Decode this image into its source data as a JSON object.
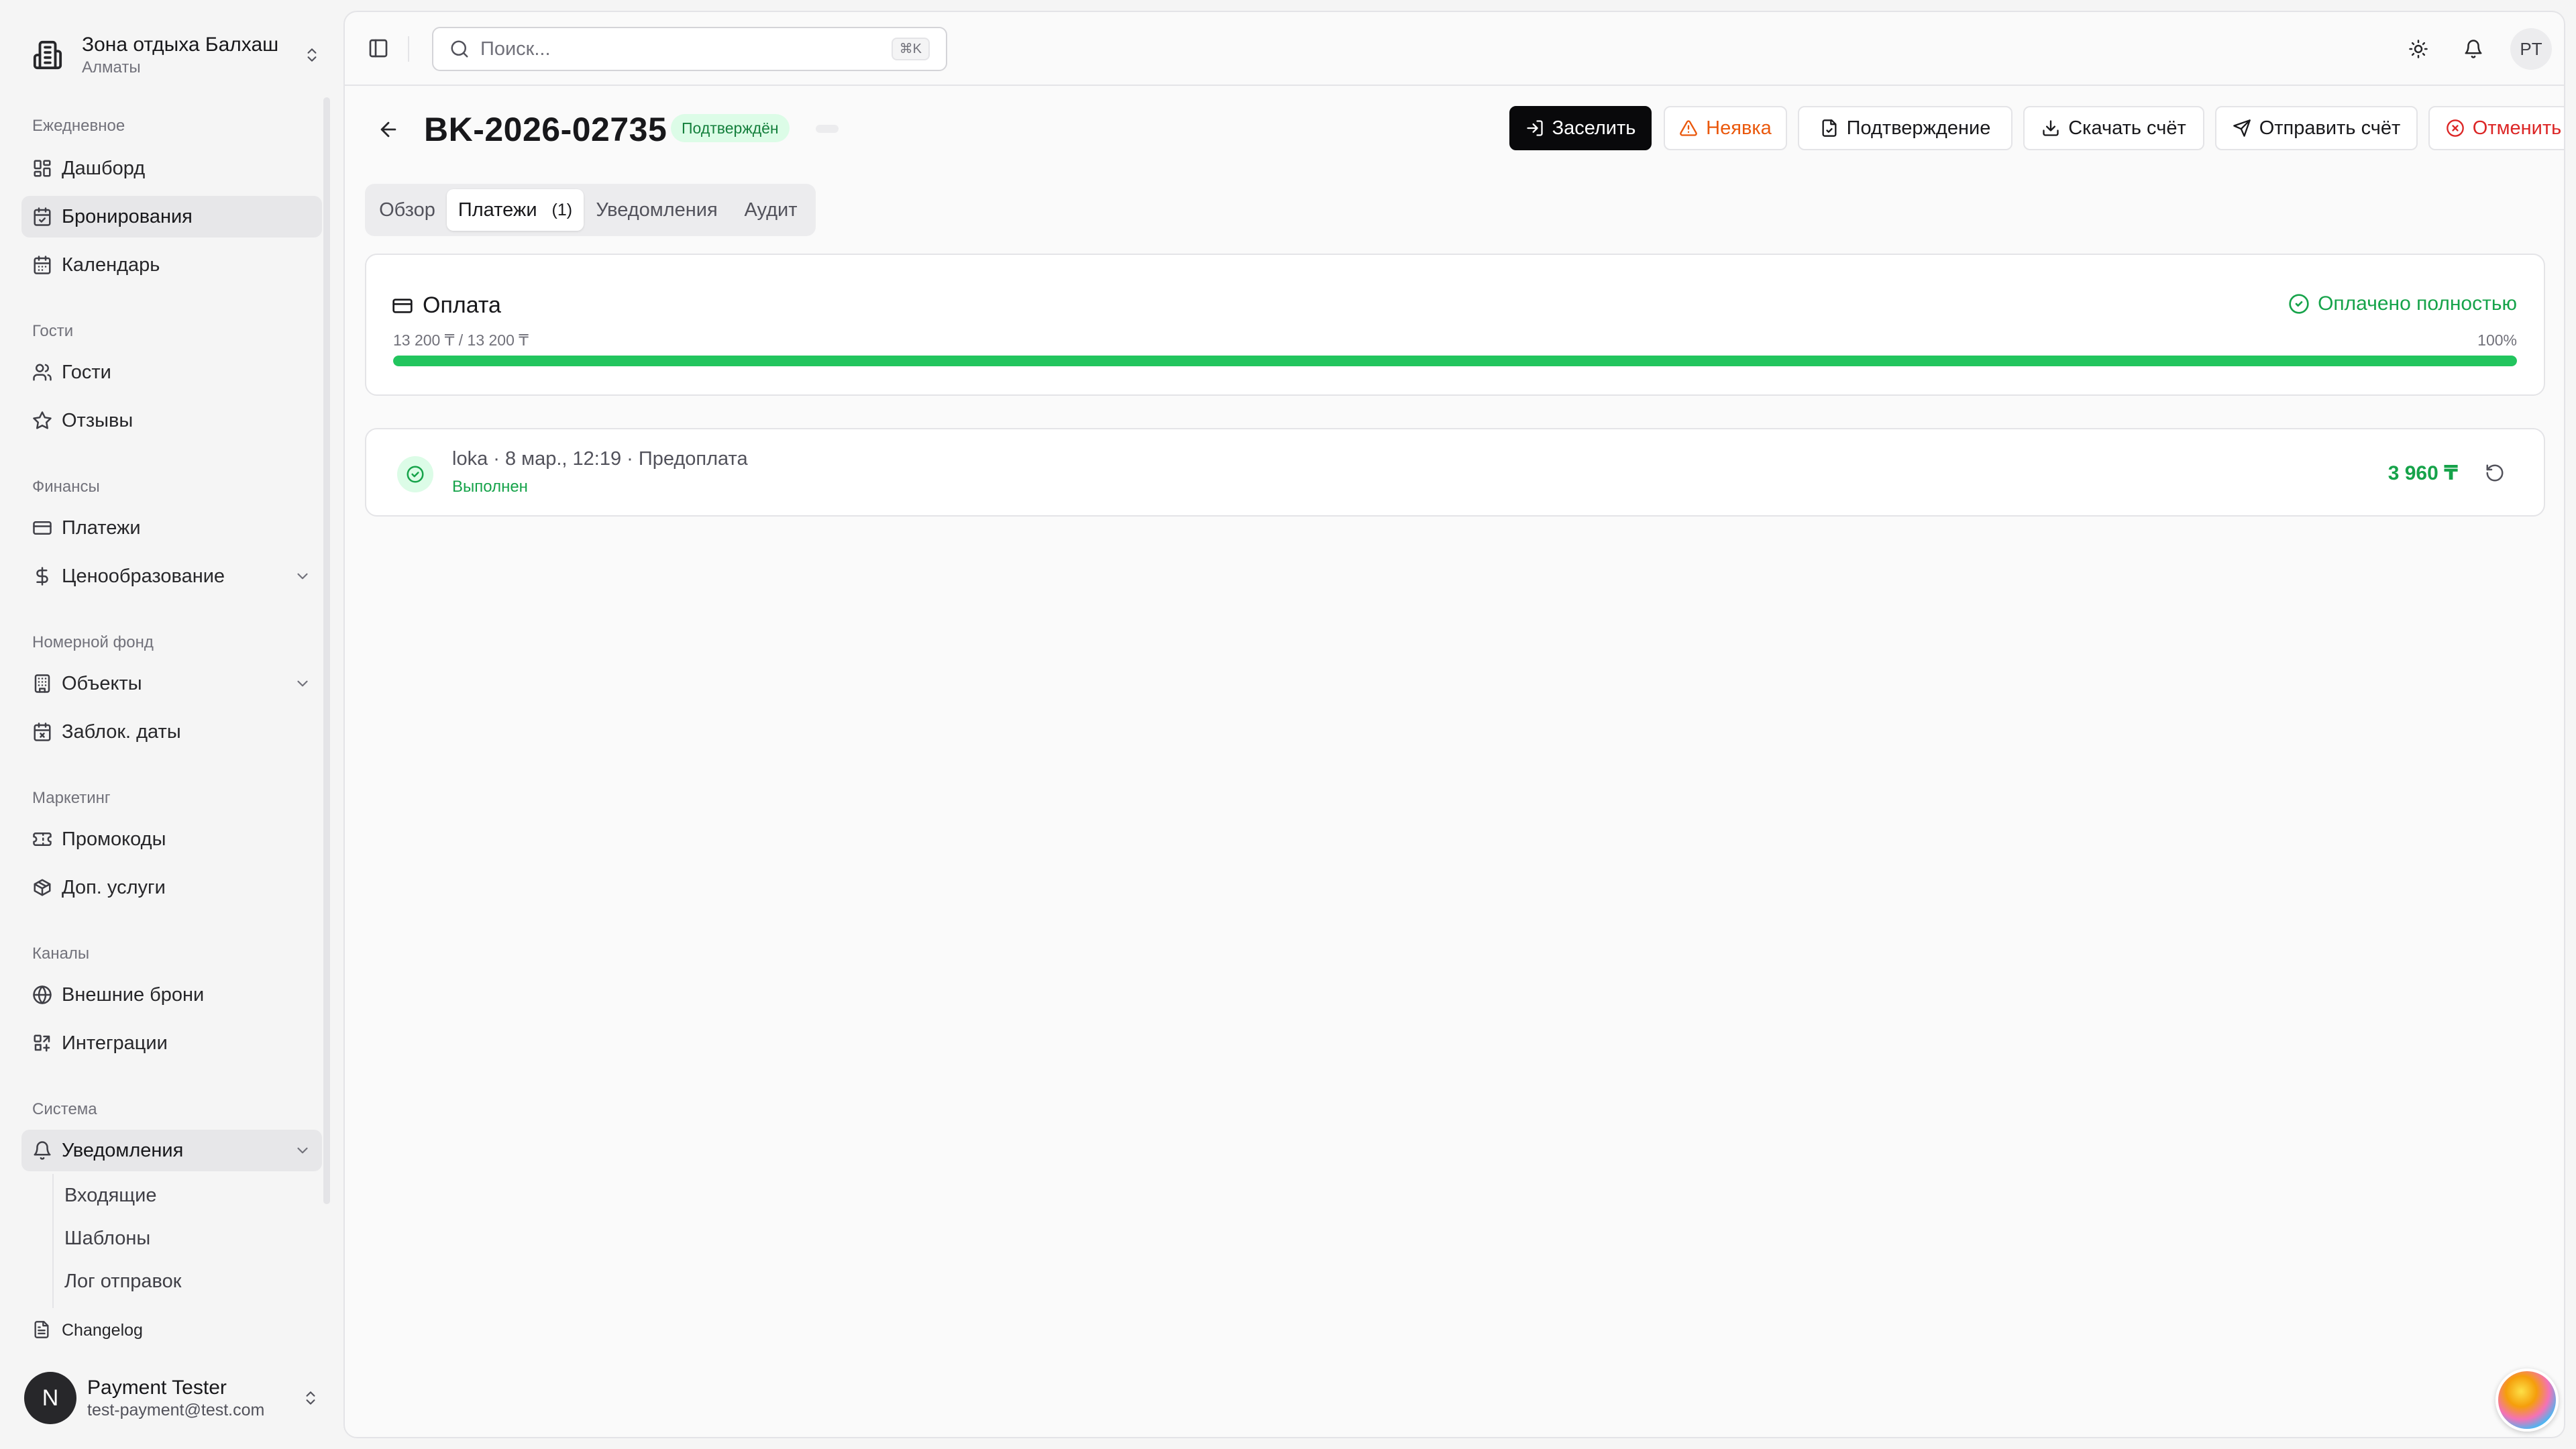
{
  "org": {
    "name": "Зона отдыха Балхаш",
    "city": "Алматы"
  },
  "nav": {
    "groups": {
      "daily": "Ежедневное",
      "guests": "Гости",
      "finance": "Финансы",
      "rooms": "Номерной фонд",
      "marketing": "Маркетинг",
      "channels": "Каналы",
      "system": "Система"
    },
    "items": {
      "dashboard": "Дашборд",
      "bookings": "Бронирования",
      "calendar": "Календарь",
      "guests": "Гости",
      "reviews": "Отзывы",
      "payments": "Платежи",
      "pricing": "Ценообразование",
      "objects": "Объекты",
      "blocked_dates": "Заблок. даты",
      "promo": "Промокоды",
      "extras": "Доп. услуги",
      "external": "Внешние брони",
      "integrations": "Интеграции",
      "notifications": "Уведомления",
      "inbox": "Входящие",
      "templates": "Шаблоны",
      "send_log": "Лог отправок",
      "changelog": "Changelog"
    },
    "active": "bookings"
  },
  "user": {
    "initial": "N",
    "name": "Payment Tester",
    "email": "test-payment@test.com"
  },
  "topbar": {
    "search_placeholder": "Поиск...",
    "shortcut": "⌘K",
    "avatar": "PT"
  },
  "booking": {
    "id": "BK-2026-02735",
    "status": "Подтверждён",
    "status_color": "#15803d"
  },
  "actions": {
    "checkin": "Заселить",
    "noshow": "Неявка",
    "confirmation": "Подтверждение",
    "download_invoice": "Скачать счёт",
    "send_invoice": "Отправить счёт",
    "cancel": "Отменить"
  },
  "tabs": {
    "overview": "Обзор",
    "payments": "Платежи",
    "payments_count": "(1)",
    "notifications": "Уведомления",
    "audit": "Аудит",
    "active": "payments"
  },
  "payment": {
    "title": "Оплата",
    "status": "Оплачено полностью",
    "amount_text": "13 200 ₸ / 13 200 ₸",
    "percent_text": "100%",
    "progress": 1.0,
    "accent_color": "#22c55e"
  },
  "transactions": [
    {
      "description": "loka · 8 мар., 12:19 · Предоплата",
      "status": "Выполнен",
      "amount": "3 960 ₸"
    }
  ]
}
